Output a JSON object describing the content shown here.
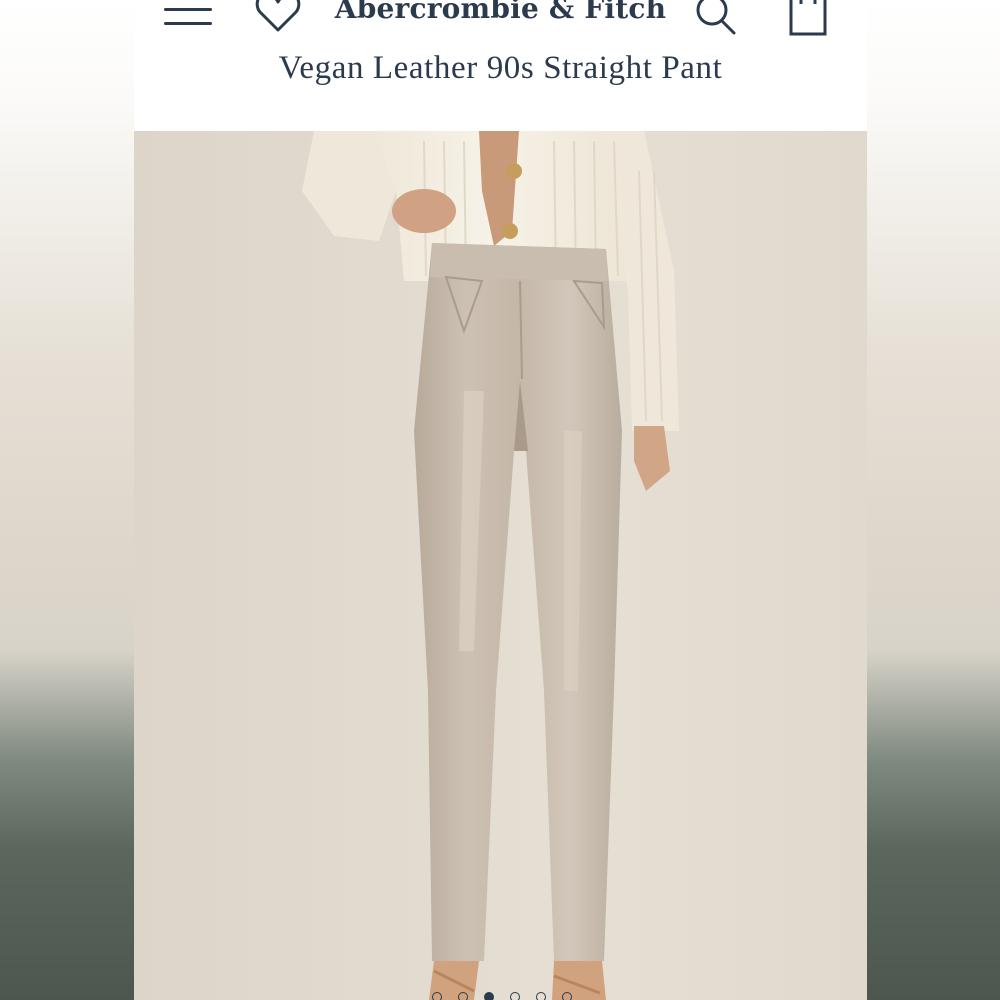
{
  "header": {
    "brand": "Abercrombie & Fitch",
    "product_title": "Vegan Leather 90s Straight Pant",
    "icons": [
      "menu-icon",
      "heart-icon",
      "search-icon",
      "bag-icon"
    ]
  },
  "colors": {
    "navy": "#2b3a4d",
    "pant": "#c8bcae",
    "sweater": "#f4efe3",
    "backdrop": "#e2dbd0"
  },
  "carousel": {
    "total_images": 6,
    "active_index": 2
  }
}
